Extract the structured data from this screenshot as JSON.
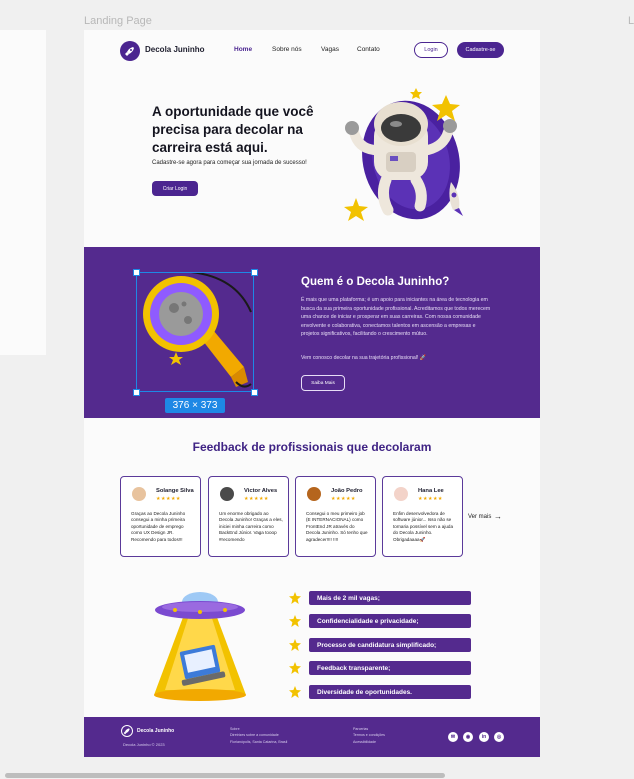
{
  "canvas": {
    "frame_label": "Landing Page",
    "right_label": "L"
  },
  "nav": {
    "brand": "Decola Juninho",
    "links": [
      "Home",
      "Sobre nós",
      "Vagas",
      "Contato"
    ],
    "login": "Login",
    "signup": "Cadastre-se"
  },
  "hero": {
    "title": "A oportunidade que você precisa para decolar na carreira está aqui.",
    "subtitle": "Cadastre-se agora para começar sua jornada de sucesso!",
    "cta": "Criar Login"
  },
  "about": {
    "title": "Quem é o Decola Juninho?",
    "body": "É mais que uma plataforma; é um apoio para iniciantes na área de tecnologia em busca da sua primeira oportunidade profissional. Acreditamos que todos merecem uma chance de iniciar e prosperar em suas carreiras. Com nossa comunidade envolvente e colaborativa, conectamos talentos em ascensão a empresas e projetos significativos, facilitando o crescimento mútuo.",
    "cta_text": "Vem conosco decolar na sua trajetória profissional! 🚀",
    "button": "Saiba Mais",
    "selection_size": "376 × 373"
  },
  "feedback": {
    "title": "Feedback de profissionais que decolaram",
    "more": "Ver mais",
    "cards": [
      {
        "name": "Solange Silva",
        "stars": "★★★★★",
        "text": "Graças ao Decola Juninho consegui a minha primeira oportunidade de emprego como UX Design JR. Recomendo para todos!!!",
        "avatar_color": "#e8c39e"
      },
      {
        "name": "Victor Alves",
        "stars": "★★★★★",
        "text": "Um enorme obrigado ao Decola Juninho! Graças a eles, iniciei minha carreira como BackEnd Júnior. Vaga tooop #recomendo",
        "avatar_color": "#4a4a4a"
      },
      {
        "name": "João Pedro",
        "stars": "★★★★★",
        "text": "Consegui o meu primeiro job (E INTERNACIONAL) como FrontEnd JR através do Decola Juninho. Só tenho que agradecer!!!! !!!!",
        "avatar_color": "#b5651d"
      },
      {
        "name": "Hana Lee",
        "stars": "★★★★★",
        "text": "Enfim desenvolvedora de software júnior... Isso não se tornaria possível sem a ajuda do Decola Juninho. Obrigadaaaa🚀",
        "avatar_color": "#f3d3c9"
      }
    ]
  },
  "features": [
    "Mais de 2 mil vagas;",
    "Confidencialidade e privacidade;",
    "Processo de candidatura simplificado;",
    "Feedback transparente;",
    "Diversidade de oportunidades."
  ],
  "footer": {
    "brand": "Decola Juninho",
    "copyright": "Decola Juninho © 2023",
    "col1": [
      "Sobre",
      "Diretrizes sobre a comunidade",
      "Florianópolis, Santa Catarina, Brasil"
    ],
    "col2": [
      "Parcerias",
      "Termos e condições",
      "Acessibilidade"
    ],
    "social_icons": [
      "email-icon",
      "whatsapp-icon",
      "linkedin-icon",
      "instagram-icon"
    ]
  },
  "colors": {
    "brand": "#542a8e",
    "accent": "#4b2590",
    "selection": "#1e88e5",
    "star": "#f2c200"
  }
}
